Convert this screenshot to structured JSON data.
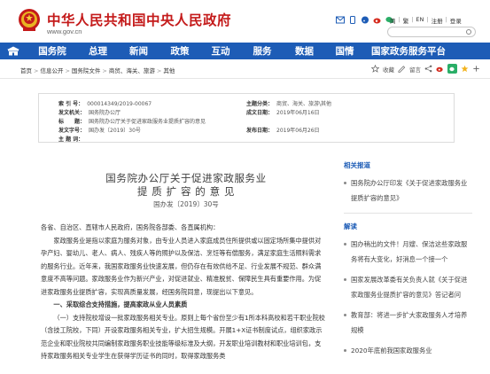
{
  "header": {
    "site_title": "中华人民共和国中央人民政府",
    "site_url": "www.gov.cn",
    "icons": [
      "mail-icon",
      "phone-icon",
      "rss-icon",
      "weibo-icon",
      "wechat-icon"
    ],
    "links": [
      "简",
      "繁",
      "EN",
      "注册",
      "登录"
    ],
    "link_separator": "|"
  },
  "nav": {
    "items": [
      "国务院",
      "总理",
      "新闻",
      "政策",
      "互动",
      "服务",
      "数据",
      "国情",
      "国家政务服务平台"
    ]
  },
  "breadcrumb": {
    "items": [
      "首页",
      "信息公开",
      "国务院文件",
      "商贸、海关、旅游",
      "其他"
    ],
    "separator": ">",
    "tools": {
      "favorite": "收藏",
      "comment": "留言"
    }
  },
  "info": {
    "index_no_label": "索 引 号：",
    "index_no": "000014349/2019-00067",
    "topic_label": "主题分类：",
    "topic": "商贸、海关、旅游\\其他",
    "issuer_label": "发文机关：",
    "issuer": "国务院办公厅",
    "date_made_label": "成文日期：",
    "date_made": "2019年06月16日",
    "title_label": "标　　题：",
    "title": "国务院办公厅关于促进家政服务业提质扩容的意见",
    "doc_no_label": "发文字号：",
    "doc_no": "国办发〔2019〕30号",
    "publish_date_label": "发布日期：",
    "publish_date": "2019年06月26日",
    "subject_label": "主 题 词："
  },
  "document": {
    "title_line1": "国务院办公厅关于促进家政服务业",
    "title_line2": "提 质 扩 容 的 意 见",
    "number": "国办发〔2019〕30号",
    "salutation": "各省、自治区、直辖市人民政府，国务院各部委、各直属机构：",
    "para1": "家政服务业是指以家庭为服务对象，由专业人员进入家庭成员住所提供或以固定场所集中提供对孕产妇、婴幼儿、老人、病人、残疾人等的照护以及保洁、烹饪等有偿服务，满足家庭生活照料需求的服务行业。近年来，我国家政服务业快速发展，但仍存在有效供给不足、行业发展不规范、群众满意度不高等问题。家政服务业作为新兴产业，对促进就业、精准脱贫、保障民生具有重要作用。为促进家政服务业提质扩容，实现高质量发展，经国务院同意，现提出以下意见。",
    "section1": "一、采取综合支持措施，提高家政从业人员素质",
    "para2": "（一）支持院校增设一批家政服务相关专业。原则上每个省份至少有1所本科高校和若干职业院校（含技工院校，下同）开设家政服务相关专业，扩大招生规模。开展1+X证书制度试点，组织家政示范企业和职业院校共同编制家政服务职业技能等级标准及大纲，开发职业培训教材和职业培训包，支持家政服务相关专业学生在获得学历证书的同时，取得家政服务类"
  },
  "sidebar": {
    "related_head": "相关报道",
    "related": [
      "国务院办公厅印发《关于促进家政服务业提质扩容的意见》"
    ],
    "interpret_head": "解读",
    "interpret": [
      "国办稍出的文件！月嫂、保洁这些家政服务将有大变化，好消息一个接一个",
      "国家发展改革委有关负责人就《关于促进家政服务业提质扩容的意见》答记者问",
      "教育部：将进一步扩大家政服务人才培养规模",
      "2020年底前我国家政服务业"
    ]
  },
  "colors": {
    "brand_red": "#c41a1a",
    "nav_blue": "#1d5cb6",
    "wechat_green": "#2aae67"
  }
}
